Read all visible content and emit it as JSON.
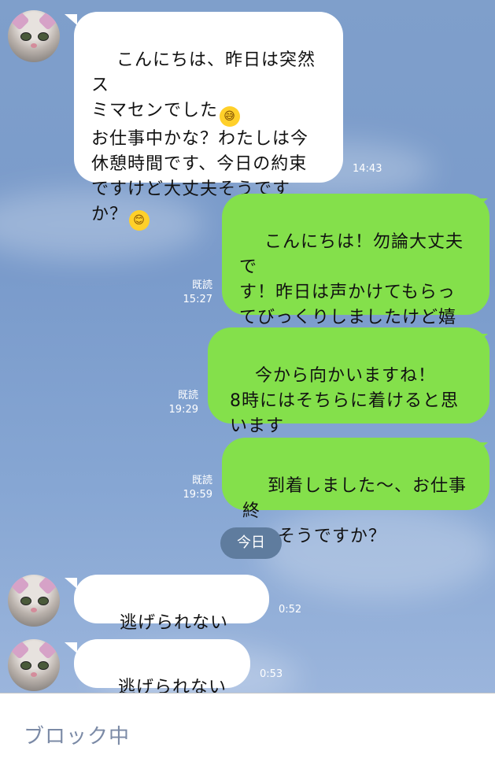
{
  "messages": [
    {
      "text1": "こんにちは、昨日は突然ス\nミマセンでした",
      "emoji1": "😅",
      "text2": "\nお仕事中かな？わたしは今\n休憩時間です、今日の約束\nですけど大丈夫そうです\nか？",
      "emoji2": "😊",
      "time": "14:43"
    },
    {
      "text1": "こんにちは！勿論大丈夫で\nす！昨日は声かけてもらっ\nてびっくりしましたけど嬉\nしかったです",
      "emoji1": "😄",
      "read": "既読",
      "time": "15:27"
    },
    {
      "text": "今から向かいますね！\n8時にはそちらに着けると思\nいます",
      "read": "既読",
      "time": "19:29"
    },
    {
      "text": "到着しました〜、お仕事終\nわれそうですか？",
      "read": "既読",
      "time": "19:59"
    },
    {
      "text": "逃げられないよ？",
      "time": "0:52"
    },
    {
      "text": "逃げられないよ",
      "time": "0:53"
    }
  ],
  "date_separator": "今日",
  "footer_status": "ブロック中",
  "colors": {
    "incoming": "#ffffff",
    "outgoing": "#84e04b",
    "background": "#7f9fcb"
  }
}
